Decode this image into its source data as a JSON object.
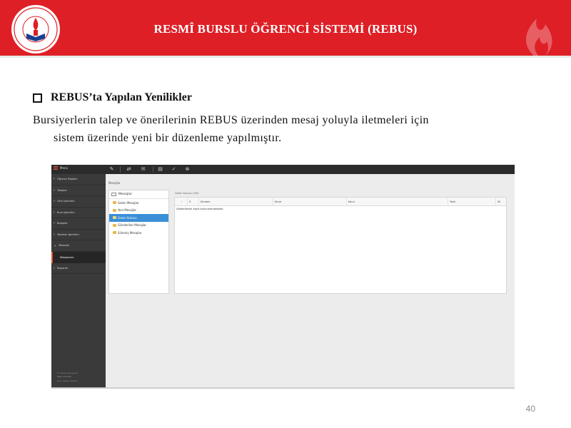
{
  "header": {
    "title": "RESMÎ BURSLU ÖĞRENCİ SİSTEMİ (REBUS)",
    "logo_text": "T.C. MİLLÎ EĞİTİM BAKANLIĞI",
    "background_color": "#de1f26"
  },
  "content": {
    "bullet_icon": "checkbox-square-icon",
    "bullet_heading": "REBUS’ta Yapılan Yenilikler",
    "paragraph_line1": "Bursiyerlerin talep ve önerilerinin REBUS üzerinden mesaj yoluyla iletmeleri için",
    "paragraph_line2": "sistem üzerinde yeni bir düzenleme yapılmıştır."
  },
  "screenshot": {
    "menu_label": "Menü",
    "toolbar_icons": [
      "compose-icon",
      "move-icon",
      "mail-icon",
      "archive-icon",
      "pin-icon",
      "close-circle-icon"
    ],
    "sidebar_items": [
      {
        "label": "Öğrenci Bilgileri",
        "expanded": false
      },
      {
        "label": "Talepler",
        "expanded": false
      },
      {
        "label": "Okul İşlemleri",
        "expanded": false
      },
      {
        "label": "Burs İşlemleri",
        "expanded": false
      },
      {
        "label": "Belgeler",
        "expanded": false
      },
      {
        "label": "Yönetim İşlemleri",
        "expanded": false
      },
      {
        "label": "Mesajlar",
        "expanded": true
      }
    ],
    "sidebar_subitem": "Mesajlarım",
    "sidebar_after_item": "Raporlar",
    "sidebar_footer": [
      "© rebus.meb.gov.tr",
      "MEB YEĞİTEK",
      "Tüm hakları saklıdır"
    ],
    "breadcrumb": "Mesajlar",
    "folder_panel_title": "Mesajlar",
    "folders": [
      {
        "label": "Gelen Mesajlar",
        "selected": false
      },
      {
        "label": "Yeni Mesajlar",
        "selected": false
      },
      {
        "label": "Gelen Kutusu",
        "selected": true
      },
      {
        "label": "Gönderilen Mesajlar",
        "selected": false
      },
      {
        "label": "Silinmiş Mesajlar",
        "selected": false
      }
    ],
    "message_list_caption": "Gelen Kutusu (0/0)",
    "message_columns": [
      "Kimden",
      "Kime",
      "Konu",
      "Tarih",
      "Sil"
    ],
    "empty_message": "Gösterilecek kayıt bulunmamaktadır."
  },
  "footer": {
    "page_number": "40"
  }
}
